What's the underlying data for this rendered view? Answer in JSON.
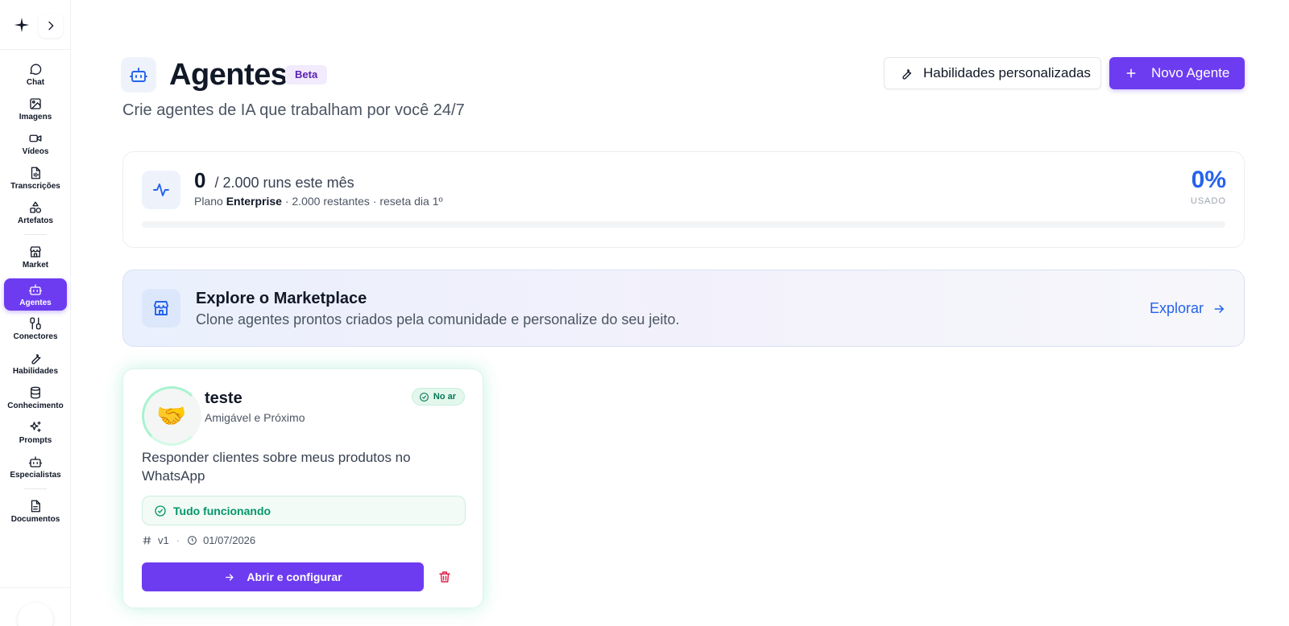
{
  "sidebar": {
    "logo_icon": "sparkle-icon",
    "expand_icon": "chevron-right-icon",
    "items": [
      {
        "label": "Chat",
        "icon": "chat-bubble-icon"
      },
      {
        "label": "Imagens",
        "icon": "image-icon"
      },
      {
        "label": "Vídeos",
        "icon": "video-camera-icon"
      },
      {
        "label": "Transcrições",
        "icon": "audio-file-icon"
      },
      {
        "label": "Artefatos",
        "icon": "shapes-icon"
      },
      {
        "label": "Market",
        "icon": "store-icon"
      },
      {
        "label": "Agentes",
        "icon": "bot-icon",
        "active": true
      },
      {
        "label": "Conectores",
        "icon": "connector-icon"
      },
      {
        "label": "Habilidades",
        "icon": "wrench-icon"
      },
      {
        "label": "Conhecimento",
        "icon": "database-icon"
      },
      {
        "label": "Prompts",
        "icon": "sparkles-icon"
      },
      {
        "label": "Especialistas",
        "icon": "bot-icon"
      },
      {
        "label": "Documentos",
        "icon": "document-icon"
      }
    ]
  },
  "header": {
    "title": "Agentes",
    "badge": "Beta",
    "subtitle": "Crie agentes de IA que trabalham por você 24/7",
    "skills_button": "Habilidades personalizadas",
    "new_button": "Novo Agente"
  },
  "usage": {
    "count": "0",
    "total_text": "/ 2.000 runs este mês",
    "plan_prefix": "Plano",
    "plan_name": "Enterprise",
    "plan_suffix": "· 2.000 restantes · reseta dia 1º",
    "percent": "0%",
    "percent_label": "USADO",
    "progress": 0
  },
  "marketplace": {
    "title": "Explore o Marketplace",
    "subtitle": "Clone agentes prontos criados pela comunidade e personalize do seu jeito.",
    "link": "Explorar"
  },
  "agents": [
    {
      "avatar": "🤝",
      "name": "teste",
      "persona": "Amigável e Próximo",
      "status": "No ar",
      "description": "Responder clientes sobre meus produtos no WhatsApp",
      "health": "Tudo funcionando",
      "version": "v1",
      "date": "01/07/2026",
      "open_button": "Abrir e configurar"
    }
  ],
  "colors": {
    "accent": "#6d3cf0",
    "link": "#2563eb",
    "success": "#059669",
    "danger": "#e11d48"
  }
}
